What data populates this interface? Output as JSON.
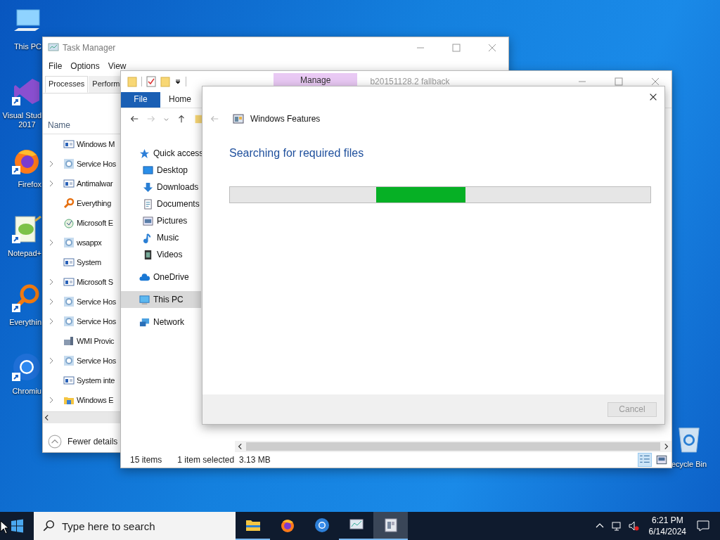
{
  "desktop_icons": [
    {
      "kind": "pc",
      "lines": [
        "This PC"
      ],
      "shortcut": false
    },
    {
      "kind": "vs",
      "lines": [
        "Visual Stud",
        "2017"
      ],
      "shortcut": true
    },
    {
      "kind": "firefox",
      "lines": [
        "Firefox"
      ],
      "shortcut": true
    },
    {
      "kind": "notepad",
      "lines": [
        "Notepad+"
      ],
      "shortcut": true
    },
    {
      "kind": "everything",
      "lines": [
        "Everythin"
      ],
      "shortcut": true
    },
    {
      "kind": "chromium",
      "lines": [
        "Chromiu"
      ],
      "shortcut": true
    }
  ],
  "recycle_bin": {
    "label": "ecycle Bin"
  },
  "task_manager": {
    "title": "Task Manager",
    "menu": [
      "File",
      "Options",
      "View"
    ],
    "tabs": [
      {
        "label": "Processes",
        "selected": true
      },
      {
        "label": "Perform",
        "selected": false
      }
    ],
    "column": "Name",
    "processes": [
      {
        "name": "Windows M",
        "kind": "window",
        "expandable": false
      },
      {
        "name": "Service Hos",
        "kind": "gear",
        "expandable": true
      },
      {
        "name": "Antimalwar",
        "kind": "window",
        "expandable": true
      },
      {
        "name": "Everything",
        "kind": "magnifier",
        "expandable": false
      },
      {
        "name": "Microsoft E",
        "kind": "defender",
        "expandable": false
      },
      {
        "name": "wsappx",
        "kind": "gear",
        "expandable": true
      },
      {
        "name": "System",
        "kind": "window",
        "expandable": false
      },
      {
        "name": "Microsoft S",
        "kind": "window",
        "expandable": true
      },
      {
        "name": "Service Hos",
        "kind": "gear",
        "expandable": true
      },
      {
        "name": "Service Hos",
        "kind": "gear",
        "expandable": true
      },
      {
        "name": "WMI Provic",
        "kind": "wmi",
        "expandable": false
      },
      {
        "name": "Service Hos",
        "kind": "gear",
        "expandable": true
      },
      {
        "name": "System inte",
        "kind": "window",
        "expandable": false
      },
      {
        "name": "Windows E",
        "kind": "folder",
        "expandable": true
      }
    ],
    "fewer_details": "Fewer details"
  },
  "explorer": {
    "context_tab": "Manage",
    "title": "b20151128.2 fallback",
    "ribbon_tabs": [
      {
        "label": "File",
        "selected": true
      },
      {
        "label": "Home",
        "selected": false
      }
    ],
    "nav": [
      {
        "label": "Quick access",
        "kind": "star",
        "sub": false,
        "selected": false
      },
      {
        "label": "Desktop",
        "kind": "desktop",
        "sub": true,
        "selected": false
      },
      {
        "label": "Downloads",
        "kind": "download",
        "sub": true,
        "selected": false
      },
      {
        "label": "Documents",
        "kind": "document",
        "sub": true,
        "selected": false
      },
      {
        "label": "Pictures",
        "kind": "picture",
        "sub": true,
        "selected": false
      },
      {
        "label": "Music",
        "kind": "music",
        "sub": true,
        "selected": false
      },
      {
        "label": "Videos",
        "kind": "video",
        "sub": true,
        "selected": false
      },
      {
        "label": "OneDrive",
        "kind": "cloud",
        "sub": false,
        "selected": false
      },
      {
        "label": "This PC",
        "kind": "pc",
        "sub": false,
        "selected": true
      },
      {
        "label": "Network",
        "kind": "network",
        "sub": false,
        "selected": false
      }
    ],
    "status": {
      "count": "15 items",
      "selection": "1 item selected",
      "size": "3.13 MB"
    }
  },
  "dialog": {
    "title": "Windows Features",
    "heading": "Searching for required files",
    "progress": {
      "indeterminate": true
    },
    "cancel": {
      "label": "Cancel",
      "disabled": true
    }
  },
  "taskbar": {
    "search_placeholder": "Type here to search",
    "apps": [
      {
        "kind": "explorer",
        "running": true,
        "selected": false
      },
      {
        "kind": "firefox",
        "running": false,
        "selected": false
      },
      {
        "kind": "chromium",
        "running": false,
        "selected": false
      },
      {
        "kind": "monitor",
        "running": true,
        "selected": false
      },
      {
        "kind": "features",
        "running": true,
        "selected": true
      }
    ],
    "time": "6:21 PM",
    "date": "6/14/2024"
  }
}
